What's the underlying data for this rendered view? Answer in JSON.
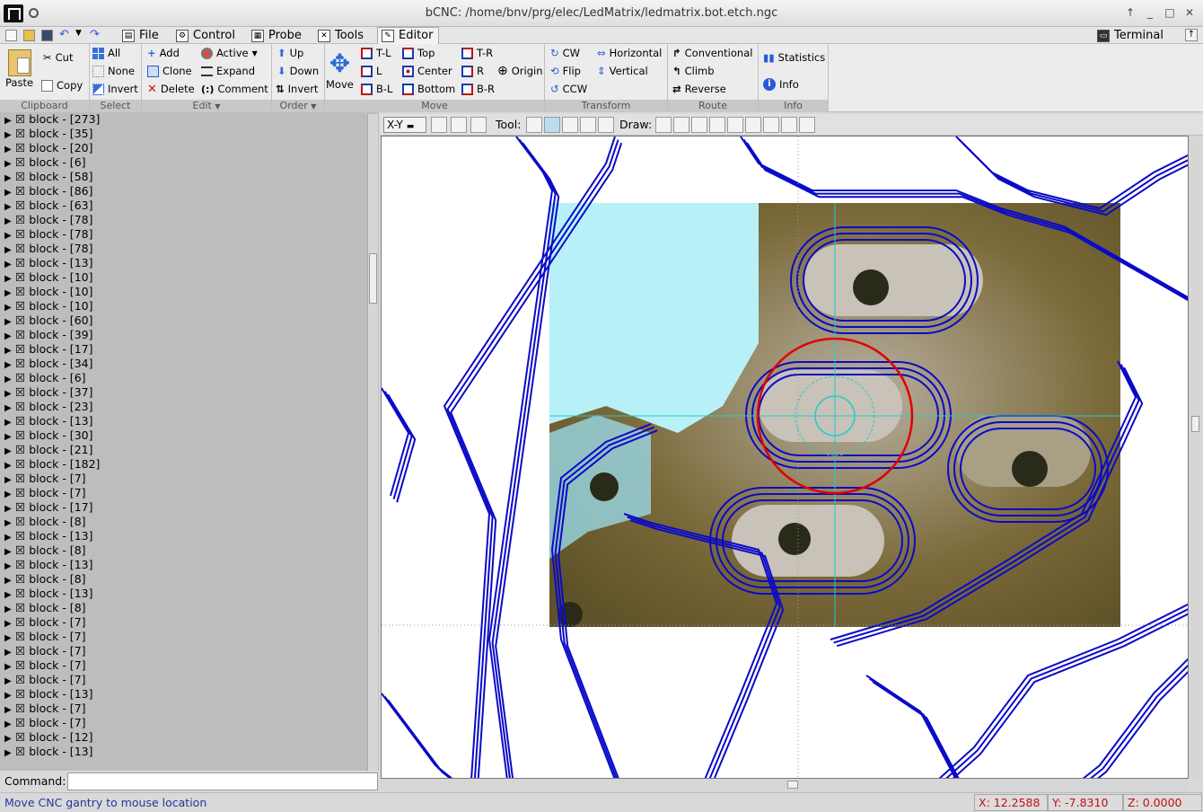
{
  "window": {
    "title": "bCNC: /home/bnv/prg/elec/LedMatrix/ledmatrix.bot.etch.ngc"
  },
  "tabs": [
    {
      "label": "File",
      "icon": "file-icon"
    },
    {
      "label": "Control",
      "icon": "control-icon"
    },
    {
      "label": "Probe",
      "icon": "probe-icon"
    },
    {
      "label": "Tools",
      "icon": "tools-icon"
    },
    {
      "label": "Editor",
      "icon": "editor-icon",
      "active": true
    }
  ],
  "terminal_tab": "Terminal",
  "ribbon": {
    "clipboard": {
      "label": "Clipboard",
      "paste": "Paste",
      "cut": "Cut",
      "copy": "Copy"
    },
    "select": {
      "label": "Select",
      "all": "All",
      "none": "None",
      "invert": "Invert"
    },
    "edit": {
      "label": "Edit",
      "add": "Add",
      "clone": "Clone",
      "delete": "Delete",
      "active": "Active",
      "expand": "Expand",
      "comment": "Comment"
    },
    "order": {
      "label": "Order",
      "up": "Up",
      "down": "Down",
      "invert": "Invert"
    },
    "move": {
      "label": "Move",
      "move": "Move",
      "tl": "T-L",
      "l": "L",
      "bl": "B-L",
      "top": "Top",
      "center": "Center",
      "bottom": "Bottom",
      "tr": "T-R",
      "r": "R",
      "br": "B-R",
      "origin": "Origin"
    },
    "transform": {
      "label": "Transform",
      "cw": "CW",
      "flip": "Flip",
      "ccw": "CCW",
      "horizontal": "Horizontal",
      "vertical": "Vertical"
    },
    "route": {
      "label": "Route",
      "conventional": "Conventional",
      "climb": "Climb",
      "reverse": "Reverse"
    },
    "info": {
      "label": "Info",
      "statistics": "Statistics",
      "info": "Info"
    }
  },
  "blocks": [
    "block - [273]",
    "block - [35]",
    "block - [20]",
    "block - [6]",
    "block - [58]",
    "block - [86]",
    "block - [63]",
    "block - [78]",
    "block - [78]",
    "block - [78]",
    "block - [13]",
    "block - [10]",
    "block - [10]",
    "block - [10]",
    "block - [60]",
    "block - [39]",
    "block - [17]",
    "block - [34]",
    "block - [6]",
    "block - [37]",
    "block - [23]",
    "block - [13]",
    "block - [30]",
    "block - [21]",
    "block - [182]",
    "block - [7]",
    "block - [7]",
    "block - [17]",
    "block - [8]",
    "block - [13]",
    "block - [8]",
    "block - [13]",
    "block - [8]",
    "block - [13]",
    "block - [8]",
    "block - [7]",
    "block - [7]",
    "block - [7]",
    "block - [7]",
    "block - [7]",
    "block - [13]",
    "block - [7]",
    "block - [7]",
    "block - [12]",
    "block - [13]"
  ],
  "command": {
    "label": "Command:",
    "value": ""
  },
  "canvas_toolbar": {
    "view": "X-Y",
    "tool_label": "Tool:",
    "draw_label": "Draw:"
  },
  "status": {
    "message": "Move CNC gantry to mouse location",
    "x": "X: 12.2588",
    "y": "Y: -7.8310",
    "z": "Z: 0.0000"
  },
  "colors": {
    "path": "#0a0ac8",
    "crosshair": "#22cccc",
    "tool_circle": "#e00000",
    "status_text": "#1f3a9c",
    "coord_text": "#c01010"
  }
}
